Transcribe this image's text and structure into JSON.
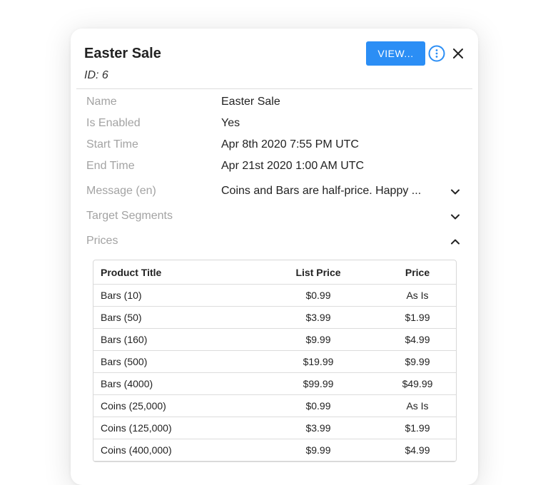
{
  "dialog": {
    "title": "Easter Sale",
    "id_label": "ID: 6",
    "view_button": "VIEW..."
  },
  "fields": [
    {
      "label": "Name",
      "value": "Easter Sale"
    },
    {
      "label": "Is Enabled",
      "value": "Yes"
    },
    {
      "label": "Start Time",
      "value": "Apr 8th 2020 7:55 PM UTC"
    },
    {
      "label": "End Time",
      "value": "Apr 21st 2020 1:00 AM UTC"
    },
    {
      "label": "Message (en)",
      "value": "Coins and Bars are half-price. Happy ...",
      "expanded": false
    },
    {
      "label": "Target Segments",
      "value": "",
      "expanded": false
    },
    {
      "label": "Prices",
      "value": "",
      "expanded": true
    }
  ],
  "prices_table": {
    "headers": [
      "Product Title",
      "List Price",
      "Price"
    ],
    "rows": [
      [
        "Bars (10)",
        "$0.99",
        "As Is"
      ],
      [
        "Bars (50)",
        "$3.99",
        "$1.99"
      ],
      [
        "Bars (160)",
        "$9.99",
        "$4.99"
      ],
      [
        "Bars (500)",
        "$19.99",
        "$9.99"
      ],
      [
        "Bars (4000)",
        "$99.99",
        "$49.99"
      ],
      [
        "Coins (25,000)",
        "$0.99",
        "As Is"
      ],
      [
        "Coins (125,000)",
        "$3.99",
        "$1.99"
      ],
      [
        "Coins (400,000)",
        "$9.99",
        "$4.99"
      ]
    ]
  },
  "colors": {
    "accent": "#2b8ef5",
    "label": "#a3a3a3",
    "text": "#222222"
  },
  "icons": {
    "info": "info-circle-icon",
    "close": "close-icon",
    "chevron_down": "chevron-down-icon",
    "chevron_up": "chevron-up-icon"
  }
}
